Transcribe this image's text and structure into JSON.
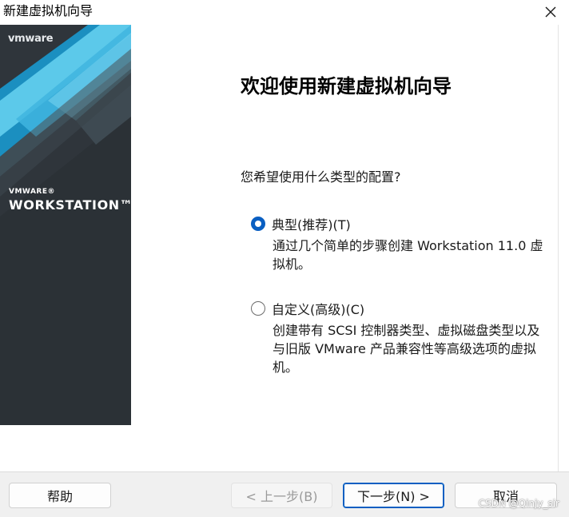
{
  "window": {
    "title": "新建虚拟机向导"
  },
  "banner": {
    "logo_text": "vmware",
    "brand_small": "VMWARE®",
    "brand_large": "WORKSTATION™"
  },
  "content": {
    "heading": "欢迎使用新建虚拟机向导",
    "question": "您希望使用什么类型的配置?",
    "options": [
      {
        "label": "典型(推荐)(T)",
        "description": "通过几个简单的步骤创建 Workstation 11.0 虚拟机。",
        "selected": true
      },
      {
        "label": "自定义(高级)(C)",
        "description": "创建带有 SCSI 控制器类型、虚拟磁盘类型以及与旧版 VMware 产品兼容性等高级选项的虚拟机。",
        "selected": false
      }
    ]
  },
  "footer": {
    "help_label": "帮助",
    "back_label": "< 上一步(B)",
    "next_label": "下一步(N) >",
    "cancel_label": "取消"
  },
  "watermark": "CSDN @Qinjy_sir",
  "colors": {
    "accent": "#0a5fc2",
    "banner_dark": "#2e3338",
    "banner_cyan": "#1ea7d6"
  },
  "icons": {
    "close": "close-icon"
  }
}
